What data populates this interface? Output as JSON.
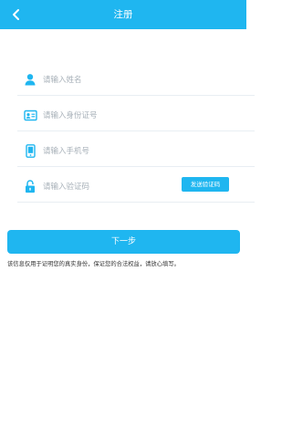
{
  "header": {
    "title": "注册",
    "back_icon": "chevron-left-icon"
  },
  "form": {
    "name": {
      "placeholder": "请输入姓名",
      "value": "",
      "icon": "user-icon"
    },
    "id_number": {
      "placeholder": "请输入身份证号",
      "value": "",
      "icon": "id-card-icon"
    },
    "phone": {
      "placeholder": "请输入手机号",
      "value": "",
      "icon": "mobile-phone-icon"
    },
    "code": {
      "placeholder": "请输入验证码",
      "value": "",
      "icon": "lock-icon",
      "send_label": "发送验证码"
    }
  },
  "actions": {
    "next_label": "下一步"
  },
  "notice": "该信息仅用于证明您的真实身份，保证您的合法权益，请放心填写。",
  "colors": {
    "accent": "#1fb6f0",
    "divider": "#e8eef3",
    "placeholder": "#a7b0b8",
    "text": "#333333"
  }
}
